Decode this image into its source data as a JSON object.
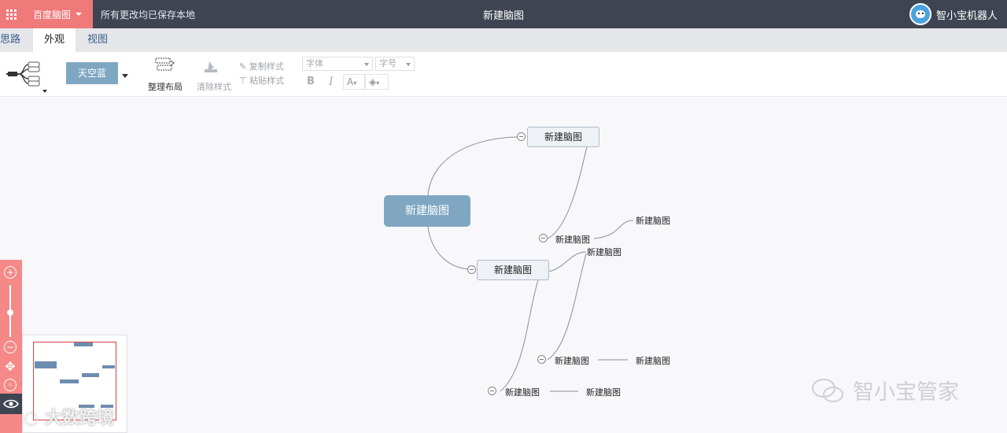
{
  "header": {
    "app_name": "百度脑图",
    "save_status": "所有更改均已保存本地",
    "doc_title": "新建脑图",
    "user_name": "智小宝机器人"
  },
  "tabs": [
    "思路",
    "外观",
    "视图"
  ],
  "active_tab": "外观",
  "toolbar": {
    "theme": "天空蓝",
    "arrange_layout": "整理布局",
    "clear_style": "清除样式",
    "copy_style": "复制样式",
    "paste_style": "粘贴样式",
    "font_family_placeholder": "字体",
    "font_size_placeholder": "字号",
    "bold": "B",
    "italic": "I",
    "font_color": "A"
  },
  "mindmap": {
    "root": "新建脑图",
    "top_branch": "新建脑图",
    "top_branch_child": "新建脑图",
    "top_branch_grandchild": "新建脑图",
    "mid_branch": "新建脑图",
    "mid_branch_child_1": "新建脑图",
    "mid_branch_child_2": "新建脑图",
    "mid_branch_child_2_sub": "新建脑图",
    "mid_branch_child_3": "新建脑图",
    "mid_branch_child_3_sub": "新建脑图"
  },
  "zoom_controls": {
    "zoom_in": "+",
    "zoom_out": "−"
  },
  "watermarks": {
    "right": "智小宝管家",
    "left": "大数跨境"
  },
  "colors": {
    "topbar": "#3f4452",
    "brand": "#f0797a",
    "root_node": "#7fa7c2",
    "theme_button": "#7fa7c2"
  }
}
